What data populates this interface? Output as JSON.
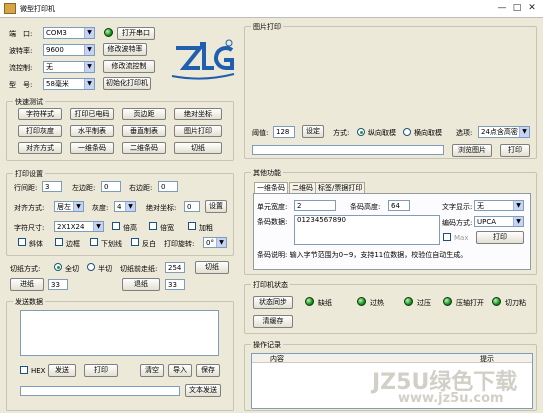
{
  "window": {
    "title": "微型打印机",
    "min": "—",
    "max": "□",
    "close": "✕"
  },
  "serial": {
    "port_label": "端　口:",
    "port_value": "COM3",
    "open_port": "打开串口",
    "baud_label": "波特率:",
    "baud_value": "9600",
    "set_baud": "修改波特率",
    "flow_label": "流控制:",
    "flow_value": "无",
    "set_flow": "修改流控制",
    "model_label": "型　号:",
    "model_value": "58毫米",
    "init_printer": "初始化打印机"
  },
  "quick_test": {
    "title": "快速测试",
    "buttons": [
      "字符样式",
      "打印已电码",
      "页边距",
      "绝对坐标",
      "打印灰度",
      "水平制表",
      "垂直制表",
      "图片打印",
      "对齐方式",
      "一维条码",
      "二维条码",
      "切纸"
    ]
  },
  "image_print": {
    "title": "图片打印",
    "threshold_label": "阈值:",
    "threshold_value": "128",
    "set": "设定",
    "mode_label": "方式:",
    "mode_vertical": "纵向取模",
    "mode_horizontal": "横向取模",
    "option_label": "选项:",
    "option_value": "24点含高密",
    "browse": "浏览图片",
    "print": "打印"
  },
  "print_settings": {
    "title": "打印设置",
    "line_spacing_label": "行间距:",
    "line_spacing": "3",
    "left_margin_label": "左边距:",
    "left_margin": "0",
    "right_margin_label": "右边距:",
    "right_margin": "0",
    "align_label": "对齐方式:",
    "align_value": "居左",
    "gray_label": "灰度:",
    "gray_value": "4",
    "abs_coord_label": "绝对坐标:",
    "abs_coord": "0",
    "setup": "设置",
    "char_size_label": "字符尺寸:",
    "char_size": "2X1X24",
    "double_height": "倍高",
    "double_width": "倍宽",
    "bold": "加粗",
    "italic": "斜体",
    "outline": "边框",
    "underline": "下划线",
    "inverse": "反白",
    "rotate_label": "打印旋转:",
    "rotate_value": "0°"
  },
  "cut": {
    "mode_label": "切纸方式:",
    "full": "全切",
    "half": "半切",
    "pre_feed_label": "切纸前走纸:",
    "pre_feed": "254",
    "cut_btn": "切纸",
    "feed_btn": "进纸",
    "feed_val": "33",
    "back_btn": "退纸",
    "back_val": "33"
  },
  "send": {
    "title": "发送数据",
    "hex": "HEX",
    "send": "发送",
    "print": "打印",
    "clear": "清空",
    "import": "导入",
    "save": "保存",
    "text_send": "文本发送"
  },
  "other": {
    "title": "其他功能",
    "tabs": [
      "一维条码",
      "二维码",
      "标签/票据打印"
    ],
    "unit_width_label": "单元宽度:",
    "unit_width": "2",
    "bar_height_label": "条码高度:",
    "bar_height": "64",
    "text_show_label": "文字显示:",
    "text_show": "无",
    "code_data_label": "条码数据:",
    "code_data": "01234567890",
    "code_type_label": "编码方式:",
    "code_type": "UPCA",
    "max_label": "Max",
    "print": "打印",
    "hint": "条码说明: 输入字节范围为0~9，支持11位数据，校验位自动生成。"
  },
  "status": {
    "title": "打印机状态",
    "sync": "状态同步",
    "clear": "清缓存",
    "items": [
      "缺纸",
      "过热",
      "过压",
      "压轴打开",
      "切刀粘"
    ]
  },
  "log": {
    "title": "操作记录",
    "col_content": "内容",
    "col_hint": "提示"
  },
  "watermark": {
    "main": "JZ5U绿色下载",
    "url": "www.jz5u.com"
  }
}
